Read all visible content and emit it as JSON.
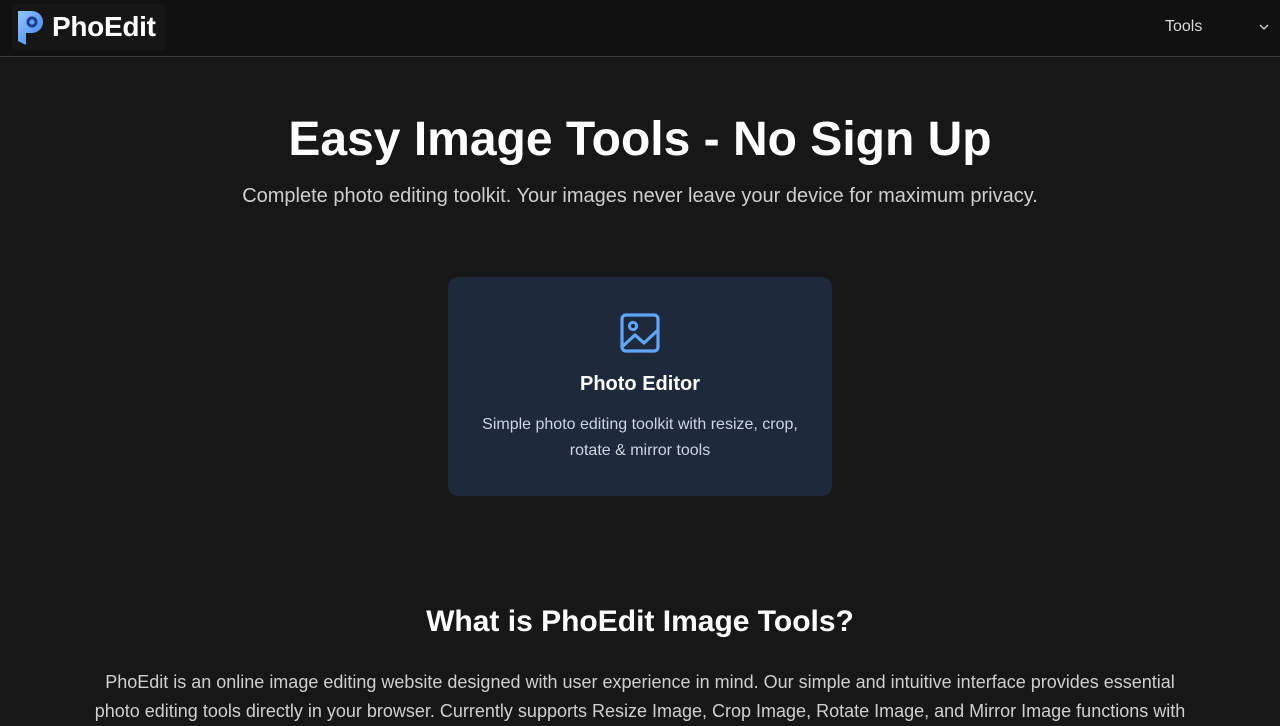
{
  "header": {
    "brand_name": "PhoEdit",
    "tools_label": "Tools",
    "icons": {
      "logo": "phoedit-p-logo",
      "menu": "chevron-down-icon"
    }
  },
  "hero": {
    "title": "Easy Image Tools - No Sign Up",
    "subtitle": "Complete photo editing toolkit. Your images never leave your device for maximum privacy."
  },
  "tool_card": {
    "icon": "image-icon",
    "title": "Photo Editor",
    "description": "Simple photo editing toolkit with resize, crop, rotate & mirror tools"
  },
  "about": {
    "title": "What is PhoEdit Image Tools?",
    "text": "PhoEdit is an online image editing website designed with user experience in mind. Our simple and intuitive interface provides essential photo editing tools directly in your browser. Currently supports Resize Image, Crop Image, Rotate Image, and Mirror Image functions with"
  },
  "colors": {
    "background": "#171717",
    "header_bg": "#111111",
    "card_bg": "#1e293b",
    "accent": "#60a5fa"
  }
}
